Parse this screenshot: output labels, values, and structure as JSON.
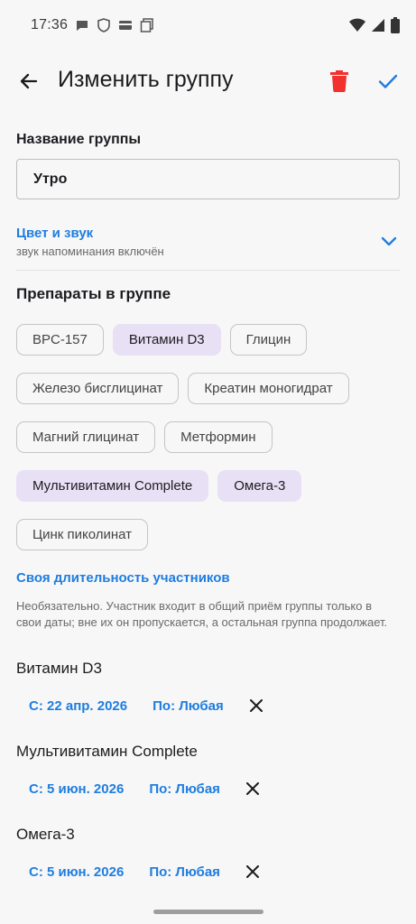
{
  "status_bar": {
    "time": "17:36",
    "left_icons": [
      "chat-bubble-icon",
      "shield-icon",
      "card-icon",
      "screen-icon"
    ],
    "right_icons": [
      "wifi-icon",
      "signal-icon",
      "battery-icon"
    ]
  },
  "app_bar": {
    "title": "Изменить группу",
    "back_icon": "arrow-left-icon",
    "delete_icon": "trash-icon",
    "confirm_icon": "check-icon",
    "delete_color": "#f2302d",
    "accent_color": "#1e7de0"
  },
  "group_name": {
    "label": "Название группы",
    "value": "Утро"
  },
  "color_sound": {
    "title": "Цвет и звук",
    "subtitle": "звук напоминания включён"
  },
  "medications": {
    "title": "Препараты в группе",
    "rows": [
      [
        {
          "label": "BPC-157",
          "selected": false
        },
        {
          "label": "Витамин D3",
          "selected": true
        },
        {
          "label": "Глицин",
          "selected": false
        }
      ],
      [
        {
          "label": "Железо бисглицинат",
          "selected": false
        },
        {
          "label": "Креатин моногидрат",
          "selected": false
        }
      ],
      [
        {
          "label": "Магний глицинат",
          "selected": false
        },
        {
          "label": "Метформин",
          "selected": false
        }
      ],
      [
        {
          "label": "Мультивитамин Complete",
          "selected": true
        },
        {
          "label": "Омега-3",
          "selected": true
        }
      ],
      [
        {
          "label": "Цинк пиколинат",
          "selected": false
        }
      ]
    ]
  },
  "own_duration": {
    "title": "Своя длительность участников",
    "description": "Необязательно. Участник входит в общий приём группы только в свои даты; вне их он пропускается, а остальная группа продолжает."
  },
  "participants": [
    {
      "name": "Витамин D3",
      "from": "С: 22 апр. 2026",
      "to": "По: Любая"
    },
    {
      "name": "Мультивитамин Complete",
      "from": "С: 5 июн. 2026",
      "to": "По: Любая"
    },
    {
      "name": "Омега-3",
      "from": "С: 5 июн. 2026",
      "to": "По: Любая"
    }
  ]
}
